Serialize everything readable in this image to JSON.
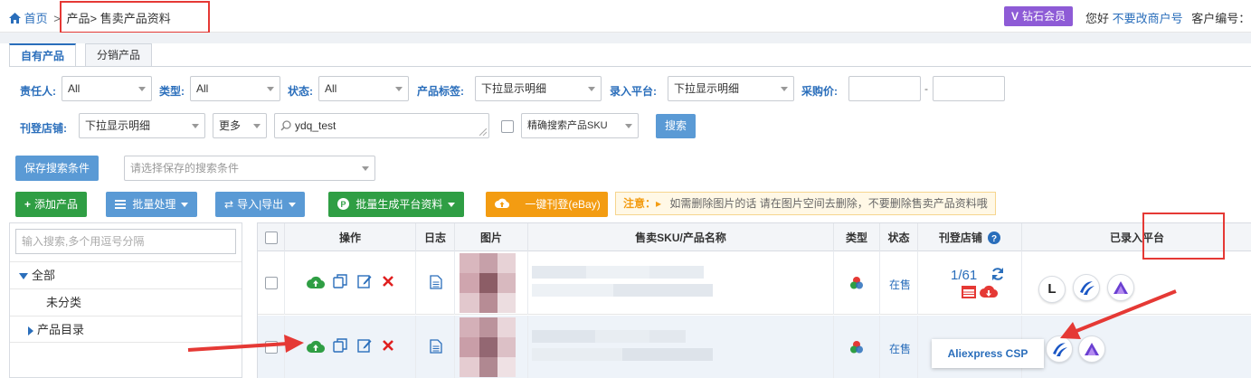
{
  "breadcrumb": {
    "home": "首页",
    "sep1": ">",
    "section": "产品>",
    "current": "售卖产品资料"
  },
  "header": {
    "vip_label": "钻石会员",
    "vip_letter": "V",
    "greeting": "您好",
    "account_link": "不要改商户号",
    "customer_id_label": "客户编号："
  },
  "tabs": [
    {
      "label": "自有产品",
      "active": true
    },
    {
      "label": "分销产品",
      "active": false
    }
  ],
  "filters": {
    "owner": {
      "label": "责任人:",
      "value": "All"
    },
    "type": {
      "label": "类型:",
      "value": "All"
    },
    "status": {
      "label": "状态:",
      "value": "All"
    },
    "tag": {
      "label": "产品标签:",
      "value": "下拉显示明细"
    },
    "platform": {
      "label": "录入平台:",
      "value": "下拉显示明细"
    },
    "price": {
      "label": "采购价:",
      "dash": "-"
    },
    "store": {
      "label": "刊登店铺:",
      "value": "下拉显示明细"
    },
    "more": {
      "value": "更多"
    },
    "search": {
      "value": "ydq_test"
    },
    "search_mode": {
      "value": "精确搜索产品SKU"
    },
    "search_button": "搜索",
    "save_button": "保存搜索条件",
    "saved_select": {
      "placeholder": "请选择保存的搜索条件"
    }
  },
  "toolbar": {
    "add": "添加产品",
    "batch": "批量处理",
    "import_export": "导入|导出",
    "generate": "批量生成平台资料",
    "publish": "一键刊登(eBay)",
    "notice_label": "注意：",
    "notice_text": "如需删除图片的话 请在图片空间去删除，不要删除售卖产品资料哦"
  },
  "tree": {
    "search_placeholder": "输入搜索,多个用逗号分隔",
    "items": [
      {
        "label": "全部"
      },
      {
        "label": "未分类"
      },
      {
        "label": "产品目录"
      }
    ]
  },
  "table": {
    "columns": [
      "操作",
      "日志",
      "图片",
      "售卖SKU/产品名称",
      "类型",
      "状态",
      "刊登店铺",
      "已录入平台"
    ],
    "rows": [
      {
        "status": "在售",
        "store_count": "1/61",
        "platforms": [
          "L"
        ]
      },
      {
        "status": "在售"
      }
    ],
    "tooltip": "Aliexpress CSP"
  },
  "colors": {
    "accent": "#2a6ebb",
    "annotation": "#e53935",
    "vip": "#8e5bd6",
    "green": "#2f9e44",
    "orange": "#f39c12"
  }
}
